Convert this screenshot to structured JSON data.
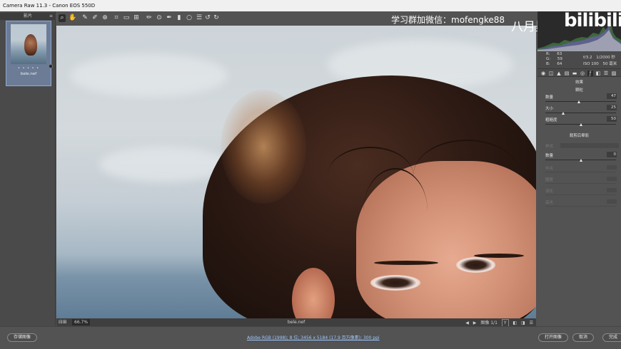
{
  "titlebar": {
    "title": "Camera Raw 11.3 -  Canon EOS 550D"
  },
  "filmstrip": {
    "header": "影片",
    "menu_icon": "≡",
    "thumbnail": {
      "stars": "• • • • •",
      "filename": "bele.nef"
    }
  },
  "toolbar": {
    "tools": [
      "zoom-icon",
      "hand-icon",
      "white-balance-icon",
      "color-sampler-icon",
      "targeted-adjustment-icon",
      "crop-icon",
      "straighten-icon",
      "transform-icon",
      "spot-removal-icon",
      "red-eye-icon",
      "adjustment-brush-icon",
      "graduated-filter-icon",
      "radial-filter-icon",
      "preferences-icon",
      "rotate-left-icon",
      "rotate-right-icon"
    ]
  },
  "watermark": {
    "text": "学习群加微信：mofengke88",
    "brand": "八月墨风",
    "logo": "bilibili"
  },
  "canvas_bar": {
    "zoom": "66.7%",
    "filename": "bele.nef",
    "nav": "图像 1/1",
    "y_label": "Y"
  },
  "info": {
    "r_label": "R:",
    "r_value": "63",
    "g_label": "G:",
    "g_value": "59",
    "b_label": "B:",
    "b_value": "64",
    "aperture": "f/3.2",
    "shutter": "1/2000 秒",
    "iso": "ISO 100",
    "focal": "50 毫米"
  },
  "panel": {
    "title": "效果",
    "grain_title": "颗粒",
    "grain": [
      {
        "label": "数量",
        "value": "47",
        "fraction": 0.47
      },
      {
        "label": "大小",
        "value": "25",
        "fraction": 0.25
      },
      {
        "label": "粗糙度",
        "value": "50",
        "fraction": 0.5
      }
    ],
    "vignette_title": "裁剪后晕影",
    "style_label": "样式",
    "vignette_amount": {
      "label": "数量",
      "value": "0",
      "fraction": 0.5
    },
    "disabled_rows": [
      "中点",
      "圆度",
      "羽化",
      "高光"
    ]
  },
  "bottombar": {
    "save_label": "存储图像",
    "workflow": "Adobe RGB (1998); 8 位; 3456 x 5184 (17.9 百万像素); 300 ppi",
    "open_label": "打开图像",
    "cancel_label": "取消",
    "done_label": "完成"
  },
  "colors": {
    "panel_bg": "#535353",
    "link": "#9fc8ff",
    "histogram_bg": "#2a2a2a"
  }
}
